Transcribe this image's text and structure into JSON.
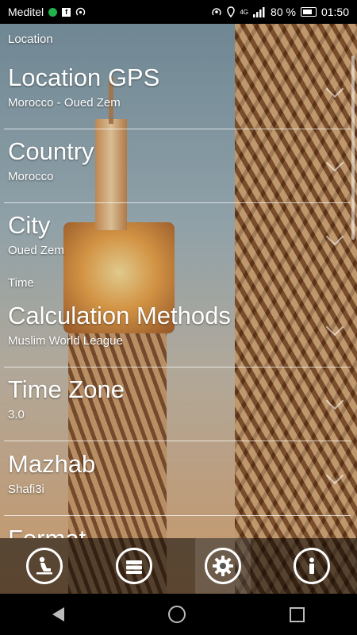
{
  "status_bar": {
    "carrier": "Meditel",
    "network": "4G",
    "battery": "80 %",
    "time": "01:50"
  },
  "sections": [
    {
      "header": "Location",
      "items": [
        {
          "title": "Location GPS",
          "value": "Morocco - Oued Zem"
        },
        {
          "title": "Country",
          "value": "Morocco"
        },
        {
          "title": "City",
          "value": "Oued Zem"
        }
      ]
    },
    {
      "header": "Time",
      "items": [
        {
          "title": "Calculation Methods",
          "value": "Muslim World League"
        },
        {
          "title": "Time Zone",
          "value": "3.0"
        },
        {
          "title": "Mazhab",
          "value": "Shafi3i"
        },
        {
          "title": "Format",
          "value": ""
        }
      ]
    }
  ],
  "bottom_tabs": [
    {
      "icon": "prayer-icon",
      "active": false
    },
    {
      "icon": "book-icon",
      "active": false
    },
    {
      "icon": "settings-icon",
      "active": true
    },
    {
      "icon": "info-icon",
      "active": false
    }
  ],
  "nav": {
    "back": "back-icon",
    "home": "home-icon",
    "recents": "recents-icon"
  }
}
